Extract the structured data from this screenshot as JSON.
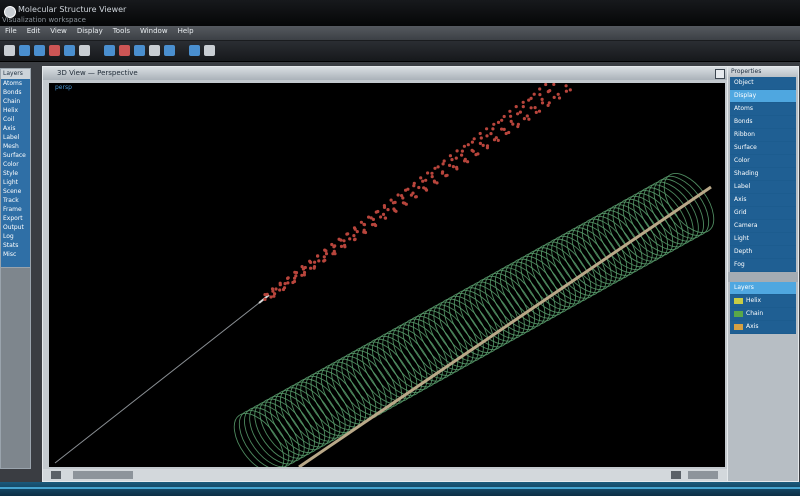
{
  "window": {
    "title": "Molecular Structure Viewer",
    "subtitle": "Visualization workspace"
  },
  "menubar": [
    {
      "label": "File"
    },
    {
      "label": "Edit"
    },
    {
      "label": "View"
    },
    {
      "label": "Display"
    },
    {
      "label": "Tools"
    },
    {
      "label": "Window"
    },
    {
      "label": "Help"
    }
  ],
  "toolbar": [
    {
      "icon": "doc-icon",
      "color": "#c9ced3"
    },
    {
      "icon": "folder-icon",
      "color": "#4a8fcf"
    },
    {
      "icon": "save-icon",
      "color": "#4a8fcf"
    },
    {
      "icon": "cut-icon",
      "color": "#cc5555"
    },
    {
      "icon": "copy-icon",
      "color": "#4a8fcf"
    },
    {
      "icon": "paste-icon",
      "color": "#c9ced3"
    },
    {
      "icon": "undo-icon",
      "color": "#4a8fcf"
    },
    {
      "icon": "redo-icon",
      "color": "#cc5555"
    },
    {
      "icon": "zoom-icon",
      "color": "#4a8fcf"
    },
    {
      "icon": "rotate-icon",
      "color": "#c9ced3"
    },
    {
      "icon": "grid-icon",
      "color": "#4a8fcf"
    },
    {
      "icon": "select-icon",
      "color": "#4a8fcf"
    },
    {
      "icon": "camera-icon",
      "color": "#c9ced3"
    }
  ],
  "left_panel": {
    "header": "Layers",
    "rows": [
      "Atoms",
      "Bonds",
      "Chain",
      "Helix",
      "Coil",
      "Axis",
      "Label",
      "Mesh",
      "Surface",
      "Color",
      "Style",
      "Light",
      "Scene",
      "Track",
      "Frame",
      "Export",
      "Output",
      "Log",
      "Stats",
      "Misc"
    ]
  },
  "viewport": {
    "title": "3D View — Perspective",
    "label": "persp"
  },
  "right_panel": {
    "header": "Properties",
    "items": [
      {
        "label": "Object"
      },
      {
        "label": "Display",
        "selected": true
      },
      {
        "label": "Atoms"
      },
      {
        "label": "Bonds"
      },
      {
        "label": "Ribbon"
      },
      {
        "label": "Surface"
      },
      {
        "label": "Color"
      },
      {
        "label": "Shading"
      },
      {
        "label": "Label"
      },
      {
        "label": "Axis"
      },
      {
        "label": "Grid"
      },
      {
        "label": "Camera"
      },
      {
        "label": "Light"
      },
      {
        "label": "Depth"
      },
      {
        "label": "Fog"
      }
    ],
    "lower_items": [
      {
        "label": "Layers",
        "selected": true
      },
      {
        "label": "Helix",
        "swatch": "#c8cc44"
      },
      {
        "label": "Chain",
        "swatch": "#5aa84a"
      },
      {
        "label": "Axis",
        "swatch": "#d4a044"
      }
    ]
  },
  "colors": {
    "helix_green": "#5aa06e",
    "chain_red": "#b8453c",
    "axis_tan": "#b9a888",
    "accent": "#4fa7e0"
  }
}
